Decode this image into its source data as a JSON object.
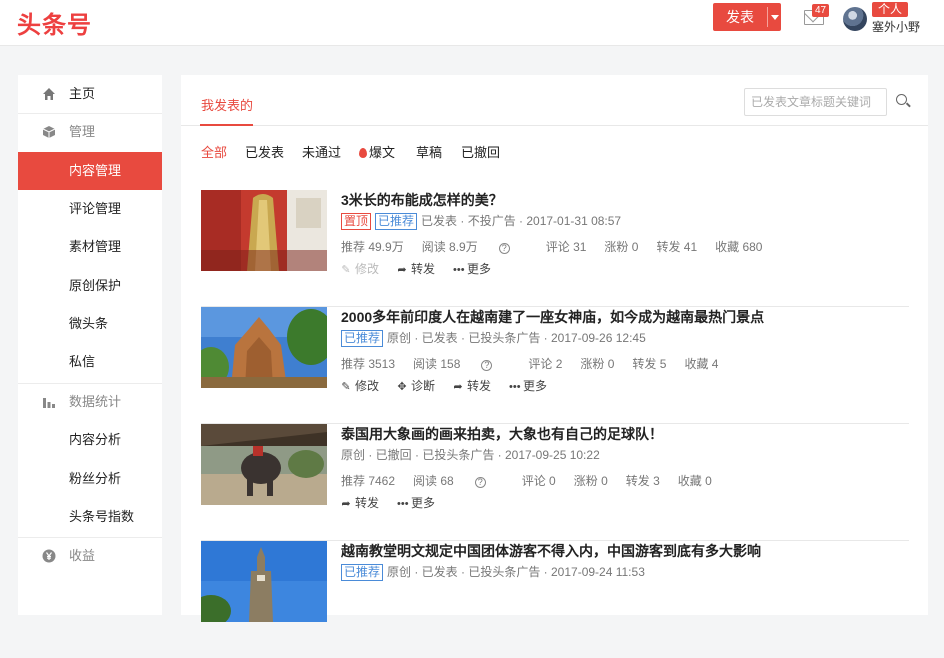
{
  "header": {
    "logo": "头条号",
    "publish_label": "发表",
    "mail_count": "47",
    "personal_badge": "个人",
    "username": "塞外小野"
  },
  "sidebar": {
    "items": [
      {
        "label": "主页",
        "icon": "home-icon"
      },
      {
        "label": "管理",
        "icon": "cube-icon"
      },
      {
        "label": "内容管理"
      },
      {
        "label": "评论管理"
      },
      {
        "label": "素材管理"
      },
      {
        "label": "原创保护"
      },
      {
        "label": "微头条"
      },
      {
        "label": "私信"
      },
      {
        "label": "数据统计",
        "icon": "bar-chart-icon"
      },
      {
        "label": "内容分析"
      },
      {
        "label": "粉丝分析"
      },
      {
        "label": "头条号指数"
      },
      {
        "label": "收益",
        "icon": "yen-icon"
      }
    ]
  },
  "main": {
    "tab": "我发表的",
    "search_placeholder": "已发表文章标题关键词",
    "filters": [
      "全部",
      "已发表",
      "未通过",
      "爆文",
      "草稿",
      "已撤回"
    ],
    "articles": [
      {
        "title": "3米长的布能成怎样的美？",
        "tags": [
          "置顶",
          "已推荐"
        ],
        "meta": "已发表 · 不投广告 · 2017-01-31 08:57",
        "stats": {
          "recommend": "推荐 49.9万",
          "read": "阅读 8.9万",
          "comment": "评论 31",
          "fans": "涨粉 0",
          "forward": "转发 41",
          "fav": "收藏 680"
        },
        "actions": {
          "edit": "修改",
          "forward": "转发",
          "more": "更多"
        }
      },
      {
        "title": "2000多年前印度人在越南建了一座女神庙，如今成为越南最热门景点",
        "tags": [
          "已推荐"
        ],
        "meta": "原创 · 已发表 · 已投头条广告 · 2017-09-26 12:45",
        "stats": {
          "recommend": "推荐 3513",
          "read": "阅读 158",
          "comment": "评论 2",
          "fans": "涨粉 0",
          "forward": "转发 5",
          "fav": "收藏 4"
        },
        "actions": {
          "edit": "修改",
          "diagnose": "诊断",
          "forward": "转发",
          "more": "更多"
        }
      },
      {
        "title": "泰国用大象画的画来拍卖，大象也有自己的足球队！",
        "meta": "原创 · 已撤回 · 已投头条广告 · 2017-09-25 10:22",
        "stats": {
          "recommend": "推荐 7462",
          "read": "阅读 68",
          "comment": "评论 0",
          "fans": "涨粉 0",
          "forward": "转发 3",
          "fav": "收藏 0"
        },
        "actions": {
          "forward": "转发",
          "more": "更多"
        }
      },
      {
        "title": "越南教堂明文规定中国团体游客不得入内，中国游客到底有多大影响",
        "tags": [
          "已推荐"
        ],
        "meta": "原创 · 已发表 · 已投头条广告 · 2017-09-24 11:53"
      }
    ]
  },
  "colors": {
    "accent": "#e84a3f",
    "recommend_tag": "#4a8bd8"
  }
}
